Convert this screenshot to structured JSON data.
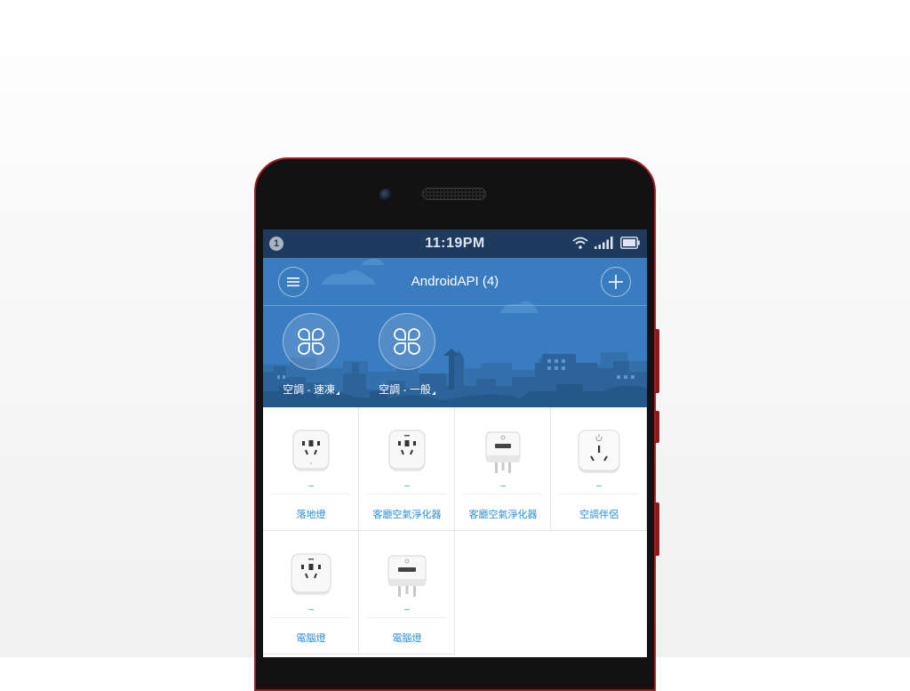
{
  "status_bar": {
    "notification_count": "1",
    "time": "11:19PM",
    "icons": [
      "wifi-icon",
      "signal-icon",
      "battery-icon"
    ]
  },
  "header": {
    "title": "AndroidAPI (4)",
    "menu_icon": "hamburger-menu-icon",
    "add_icon": "plus-icon"
  },
  "scenes": [
    {
      "label": "空調 - 速凍",
      "icon": "clover-icon"
    },
    {
      "label": "空調 - 一般",
      "icon": "clover-icon"
    }
  ],
  "devices": [
    {
      "name": "落地燈",
      "status": "–",
      "icon": "smart-plug-icon"
    },
    {
      "name": "客廳空氣淨化器",
      "status": "–",
      "icon": "smart-plug-icon"
    },
    {
      "name": "客廳空氣淨化器",
      "status": "–",
      "icon": "usb-plug-icon"
    },
    {
      "name": "空調伴侶",
      "status": "–",
      "icon": "ac-companion-icon"
    },
    {
      "name": "電腦燈",
      "status": "–",
      "icon": "smart-plug-icon"
    },
    {
      "name": "電腦燈",
      "status": "–",
      "icon": "usb-plug-icon"
    }
  ],
  "colors": {
    "header_blue": "#3a7cc0",
    "status_bar": "#1e3b5e",
    "accent_text": "#2a8fd8",
    "phone_frame": "#9e1e23"
  }
}
